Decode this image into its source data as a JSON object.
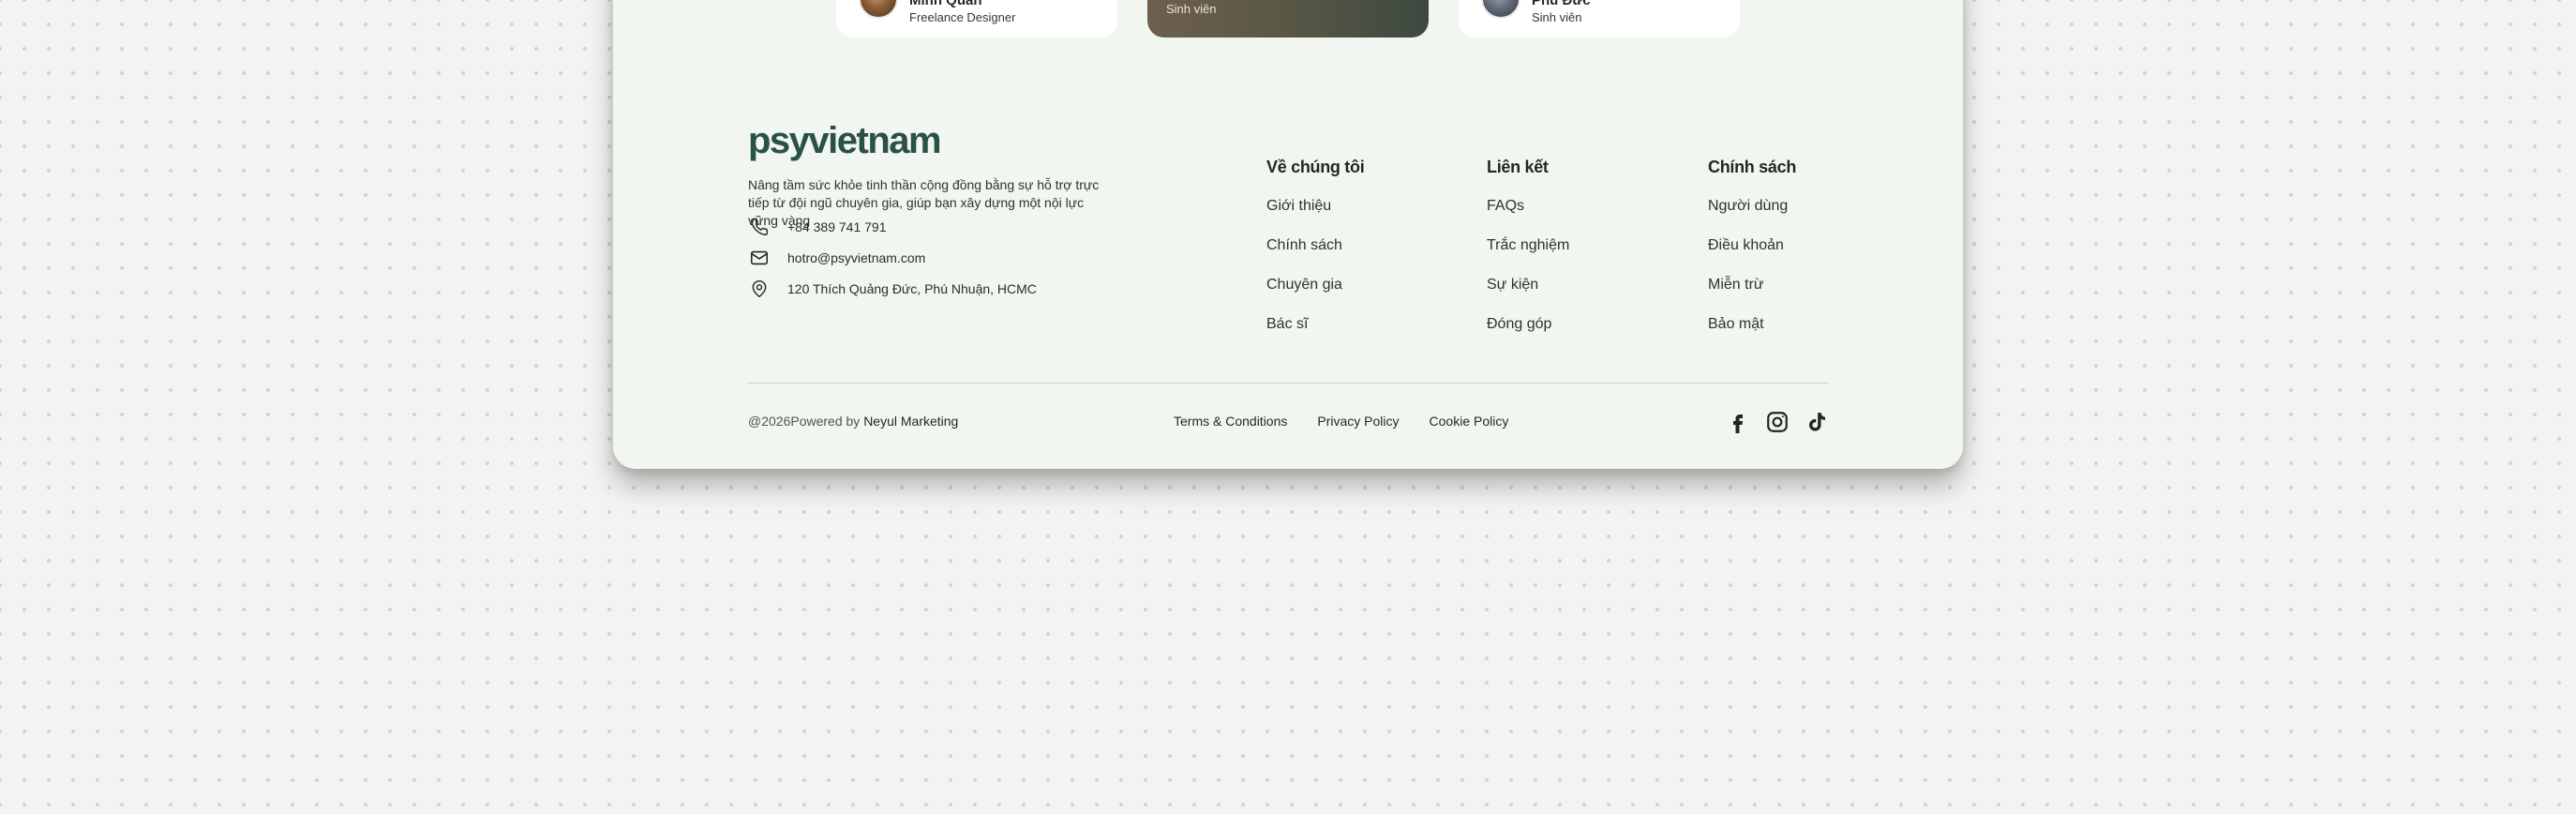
{
  "testimonials": [
    {
      "name": "Minh Quân",
      "role": "Freelance Designer"
    },
    {
      "name": "",
      "role": "Sinh viên"
    },
    {
      "name": "Phú Đức",
      "role": "Sinh viên"
    }
  ],
  "footer": {
    "brand": "psyvietnam",
    "tagline": "Nâng tầm sức khỏe tinh thần cộng đồng bằng sự hỗ trợ trực tiếp từ đội ngũ chuyên gia, giúp bạn xây dựng một nội lực vững vàng",
    "contact": {
      "phone": "+84 389 741 791",
      "email": "hotro@psyvietnam.com",
      "address": "120 Thích Quảng Đức, Phú Nhuận, HCMC"
    },
    "columns": [
      {
        "title": "Về chúng tôi",
        "links": [
          "Giới thiệu",
          "Chính sách",
          "Chuyên gia",
          "Bác sĩ"
        ]
      },
      {
        "title": "Liên kết",
        "links": [
          "FAQs",
          "Trắc nghiệm",
          "Sự kiện",
          "Đóng góp"
        ]
      },
      {
        "title": "Chính sách",
        "links": [
          "Người dùng",
          "Điều khoản",
          "Miễn trừ",
          "Bảo mật"
        ]
      }
    ],
    "copyright": {
      "prefix": "@2026Powered by ",
      "company": "Neyul Marketing"
    },
    "legal": [
      "Terms & Conditions",
      "Privacy Policy",
      "Cookie Policy"
    ],
    "social_icons": [
      "facebook-icon",
      "instagram-icon",
      "tiktok-icon"
    ]
  },
  "colors": {
    "page_bg": "#f3f3f1",
    "card_bg": "#f1f6f0",
    "brand": "#2a5147",
    "text": "#1e2824"
  }
}
